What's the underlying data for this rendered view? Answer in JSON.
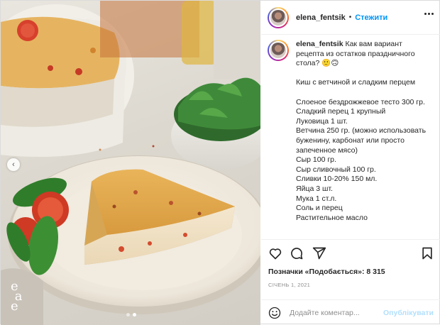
{
  "post": {
    "username": "elena_fentsik",
    "follow_label": "Стежити",
    "header_separator": "•",
    "caption": {
      "intro": "Как вам вариант рецепта из остатков праздничного стола?",
      "intro_emoji": "🙂🙃",
      "lines": [
        "Киш с ветчиной и сладким перцем",
        "",
        "Слоеное бездрожжевое тесто 300 гр.",
        "Сладкий перец 1 крупный",
        "Луковица 1 шт.",
        "Ветчина 250 гр. (можно использовать буженину, карбонат или просто запеченное мясо)",
        "Сыр 100 гр.",
        "Сыр сливочный 100 гр.",
        "Сливки 10-20% 150 мл.",
        "Яйца 3 шт.",
        "Мука 1 ст.л.",
        "Соль и перец",
        "Растительное масло"
      ]
    },
    "likes_text": "Позначки «Подобається»: 8 315",
    "date": "СІЧЕНЬ 1, 2021",
    "comment_placeholder": "Додайте коментар...",
    "publish_label": "Опублікувати",
    "watermark": "e a e",
    "carousel": {
      "slides": 2,
      "active_slide": 2
    }
  },
  "icons": {
    "like": "heart-icon",
    "comment": "comment-icon",
    "share": "share-icon",
    "save": "bookmark-icon",
    "more": "more-options-icon",
    "emoji": "emoji-icon",
    "prev": "chevron-left-icon"
  },
  "colors": {
    "accent": "#0095f6",
    "publish_disabled": "#b2dffc",
    "text": "#262626",
    "muted": "#8e8e8e"
  }
}
